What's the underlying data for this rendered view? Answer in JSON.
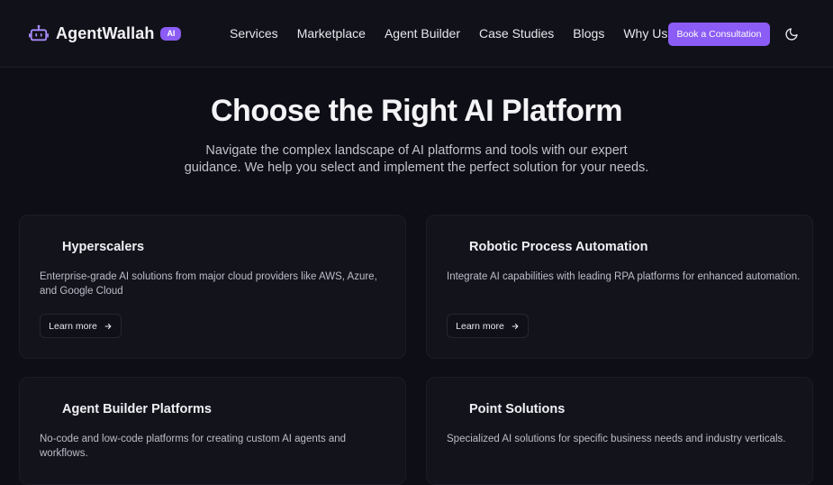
{
  "brand": {
    "name": "AgentWallah",
    "badge": "AI"
  },
  "nav": {
    "links": [
      "Services",
      "Marketplace",
      "Agent Builder",
      "Case Studies",
      "Blogs",
      "Why Us"
    ],
    "cta": "Book a Consultation"
  },
  "hero": {
    "title": "Choose the Right AI Platform",
    "subtitle": "Navigate the complex landscape of AI platforms and tools with our expert guidance. We help you select and implement the perfect solution for your needs."
  },
  "cards": [
    {
      "title": "Hyperscalers",
      "description": "Enterprise-grade AI solutions from major cloud providers like AWS, Azure, and Google Cloud",
      "button": "Learn more"
    },
    {
      "title": "Robotic Process Automation",
      "description": "Integrate AI capabilities with leading RPA platforms for enhanced automation.",
      "button": "Learn more"
    },
    {
      "title": "Agent Builder Platforms",
      "description": "No-code and low-code platforms for creating custom AI agents and workflows."
    },
    {
      "title": "Point Solutions",
      "description": "Specialized AI solutions for specific business needs and industry verticals."
    }
  ],
  "colors": {
    "accent": "#8b5cf6",
    "background": "#0e0e16",
    "card": "#13131c"
  }
}
